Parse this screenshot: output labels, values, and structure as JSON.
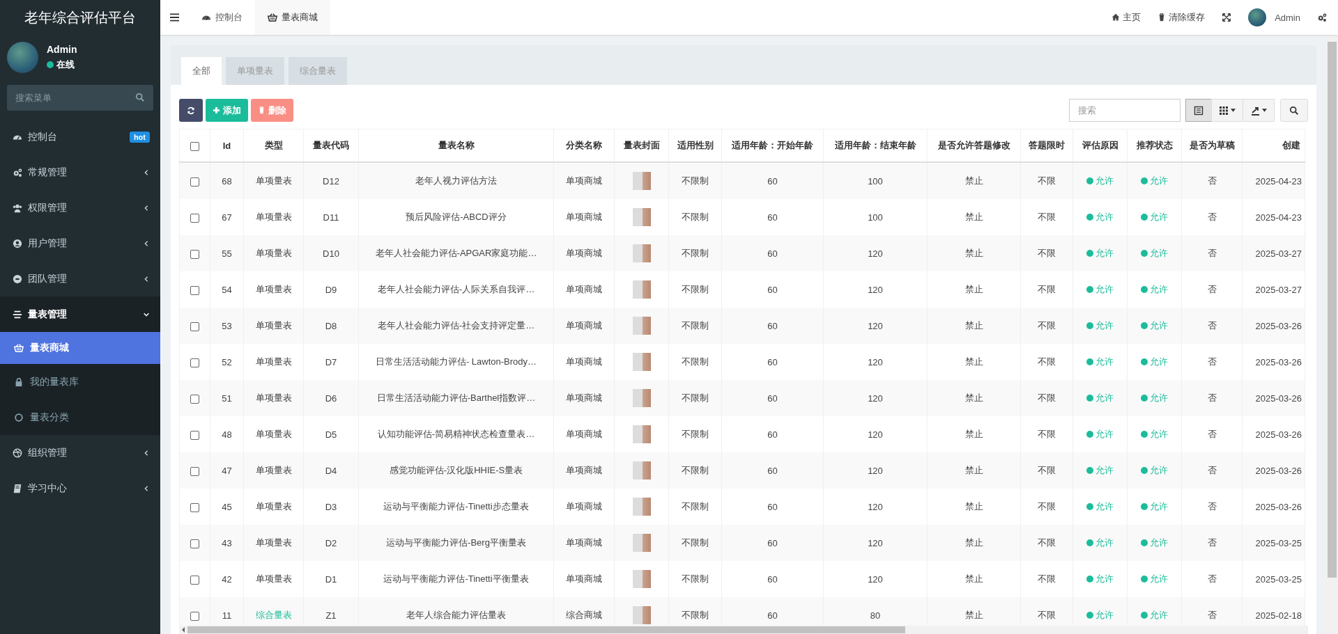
{
  "app": {
    "title": "老年综合评估平台"
  },
  "user": {
    "name": "Admin",
    "status": "在线"
  },
  "sidebar": {
    "search": {
      "placeholder": "搜索菜单"
    },
    "items": [
      {
        "label": "控制台",
        "badge": "hot",
        "expanded": false
      },
      {
        "label": "常规管理",
        "expanded": false
      },
      {
        "label": "权限管理",
        "expanded": false
      },
      {
        "label": "用户管理",
        "expanded": false
      },
      {
        "label": "团队管理",
        "expanded": false
      },
      {
        "label": "量表管理",
        "expanded": true,
        "children": [
          {
            "label": "量表商城",
            "selected": true
          },
          {
            "label": "我的量表库",
            "selected": false
          },
          {
            "label": "量表分类",
            "selected": false
          }
        ]
      },
      {
        "label": "组织管理",
        "expanded": false
      },
      {
        "label": "学习中心",
        "expanded": false
      }
    ]
  },
  "topbar": {
    "page_tabs": [
      {
        "label": "控制台",
        "selected": false
      },
      {
        "label": "量表商城",
        "selected": true
      }
    ],
    "actions": [
      "主页",
      "清除缓存"
    ],
    "user": "Admin"
  },
  "panel": {
    "tabs": [
      {
        "label": "全部",
        "selected": true
      },
      {
        "label": "单项量表",
        "selected": false
      },
      {
        "label": "综合量表",
        "selected": false
      }
    ],
    "toolbar": {
      "buttons": [
        {
          "kind": "refresh"
        },
        {
          "kind": "add",
          "label": "添加"
        },
        {
          "kind": "delete",
          "label": "删除"
        }
      ],
      "search": {
        "placeholder": "搜索"
      }
    },
    "table": {
      "select_all_checked": false,
      "columns": [
        "Id",
        "类型",
        "量表代码",
        "量表名称",
        "分类名称",
        "量表封面",
        "适用性别",
        "适用年龄：开始年龄",
        "适用年龄：结束年龄",
        "是否允许答题修改",
        "答题限时",
        "评估原因",
        "推荐状态",
        "是否为草稿",
        "创建"
      ],
      "rows": [
        {
          "checked": false,
          "id": "68",
          "type": {
            "text": "单项量表",
            "kind": "single"
          },
          "code": "D12",
          "name": "老年人视力评估方法",
          "category": "单项商城",
          "gender": "不限制",
          "age_start": "60",
          "age_end": "100",
          "allow_edit": "禁止",
          "time_limit": "不限",
          "reason": "允许",
          "recommend": "允许",
          "draft": "否",
          "created": "2025-04-23"
        },
        {
          "checked": false,
          "id": "67",
          "type": {
            "text": "单项量表",
            "kind": "single"
          },
          "code": "D11",
          "name": "预后风险评估-ABCD评分",
          "category": "单项商城",
          "gender": "不限制",
          "age_start": "60",
          "age_end": "100",
          "allow_edit": "禁止",
          "time_limit": "不限",
          "reason": "允许",
          "recommend": "允许",
          "draft": "否",
          "created": "2025-04-23"
        },
        {
          "checked": false,
          "id": "55",
          "type": {
            "text": "单项量表",
            "kind": "single"
          },
          "code": "D10",
          "name": "老年人社会能力评估-APGAR家庭功能…",
          "category": "单项商城",
          "gender": "不限制",
          "age_start": "60",
          "age_end": "120",
          "allow_edit": "禁止",
          "time_limit": "不限",
          "reason": "允许",
          "recommend": "允许",
          "draft": "否",
          "created": "2025-03-27"
        },
        {
          "checked": false,
          "id": "54",
          "type": {
            "text": "单项量表",
            "kind": "single"
          },
          "code": "D9",
          "name": "老年人社会能力评估-人际关系自我评…",
          "category": "单项商城",
          "gender": "不限制",
          "age_start": "60",
          "age_end": "120",
          "allow_edit": "禁止",
          "time_limit": "不限",
          "reason": "允许",
          "recommend": "允许",
          "draft": "否",
          "created": "2025-03-27"
        },
        {
          "checked": false,
          "id": "53",
          "type": {
            "text": "单项量表",
            "kind": "single"
          },
          "code": "D8",
          "name": "老年人社会能力评估-社会支持评定量…",
          "category": "单项商城",
          "gender": "不限制",
          "age_start": "60",
          "age_end": "120",
          "allow_edit": "禁止",
          "time_limit": "不限",
          "reason": "允许",
          "recommend": "允许",
          "draft": "否",
          "created": "2025-03-26"
        },
        {
          "checked": false,
          "id": "52",
          "type": {
            "text": "单项量表",
            "kind": "single"
          },
          "code": "D7",
          "name": "日常生活活动能力评估- Lawton-Brody…",
          "category": "单项商城",
          "gender": "不限制",
          "age_start": "60",
          "age_end": "120",
          "allow_edit": "禁止",
          "time_limit": "不限",
          "reason": "允许",
          "recommend": "允许",
          "draft": "否",
          "created": "2025-03-26"
        },
        {
          "checked": false,
          "id": "51",
          "type": {
            "text": "单项量表",
            "kind": "single"
          },
          "code": "D6",
          "name": "日常生活活动能力评估-Barthel指数评…",
          "category": "单项商城",
          "gender": "不限制",
          "age_start": "60",
          "age_end": "120",
          "allow_edit": "禁止",
          "time_limit": "不限",
          "reason": "允许",
          "recommend": "允许",
          "draft": "否",
          "created": "2025-03-26"
        },
        {
          "checked": false,
          "id": "48",
          "type": {
            "text": "单项量表",
            "kind": "single"
          },
          "code": "D5",
          "name": "认知功能评估-简易精神状态检查量表…",
          "category": "单项商城",
          "gender": "不限制",
          "age_start": "60",
          "age_end": "120",
          "allow_edit": "禁止",
          "time_limit": "不限",
          "reason": "允许",
          "recommend": "允许",
          "draft": "否",
          "created": "2025-03-26"
        },
        {
          "checked": false,
          "id": "47",
          "type": {
            "text": "单项量表",
            "kind": "single"
          },
          "code": "D4",
          "name": "感觉功能评估-汉化版HHIE-S量表",
          "category": "单项商城",
          "gender": "不限制",
          "age_start": "60",
          "age_end": "120",
          "allow_edit": "禁止",
          "time_limit": "不限",
          "reason": "允许",
          "recommend": "允许",
          "draft": "否",
          "created": "2025-03-26"
        },
        {
          "checked": false,
          "id": "45",
          "type": {
            "text": "单项量表",
            "kind": "single"
          },
          "code": "D3",
          "name": "运动与平衡能力评估-Tinetti步态量表",
          "category": "单项商城",
          "gender": "不限制",
          "age_start": "60",
          "age_end": "120",
          "allow_edit": "禁止",
          "time_limit": "不限",
          "reason": "允许",
          "recommend": "允许",
          "draft": "否",
          "created": "2025-03-26"
        },
        {
          "checked": false,
          "id": "43",
          "type": {
            "text": "单项量表",
            "kind": "single"
          },
          "code": "D2",
          "name": "运动与平衡能力评估-Berg平衡量表",
          "category": "单项商城",
          "gender": "不限制",
          "age_start": "60",
          "age_end": "120",
          "allow_edit": "禁止",
          "time_limit": "不限",
          "reason": "允许",
          "recommend": "允许",
          "draft": "否",
          "created": "2025-03-25"
        },
        {
          "checked": false,
          "id": "42",
          "type": {
            "text": "单项量表",
            "kind": "single"
          },
          "code": "D1",
          "name": "运动与平衡能力评估-Tinetti平衡量表",
          "category": "单项商城",
          "gender": "不限制",
          "age_start": "60",
          "age_end": "120",
          "allow_edit": "禁止",
          "time_limit": "不限",
          "reason": "允许",
          "recommend": "允许",
          "draft": "否",
          "created": "2025-03-25"
        },
        {
          "checked": false,
          "id": "11",
          "type": {
            "text": "综合量表",
            "kind": "composite"
          },
          "code": "Z1",
          "name": "老年人综合能力评估量表",
          "category": "综合商城",
          "gender": "不限制",
          "age_start": "60",
          "age_end": "80",
          "allow_edit": "禁止",
          "time_limit": "不限",
          "reason": "允许",
          "recommend": "允许",
          "draft": "否",
          "created": "2025-02-18"
        }
      ]
    }
  }
}
